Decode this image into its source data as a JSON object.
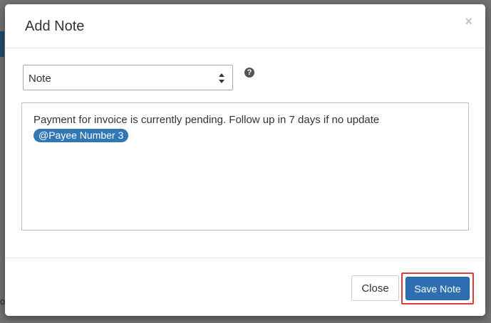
{
  "modal": {
    "title": "Add Note",
    "close_glyph": "×"
  },
  "note_type_select": {
    "selected": "Note"
  },
  "help": {
    "glyph": "?"
  },
  "note": {
    "text": "Payment for invoice is currently pending. Follow up in 7 days if no update",
    "mention": "@Payee Number 3"
  },
  "footer": {
    "close_label": "Close",
    "save_label": "Save Note"
  },
  "background": {
    "edge_char": "o"
  },
  "colors": {
    "primary": "#2d6fb0",
    "mention": "#3177b3",
    "highlight": "#e0393e"
  }
}
